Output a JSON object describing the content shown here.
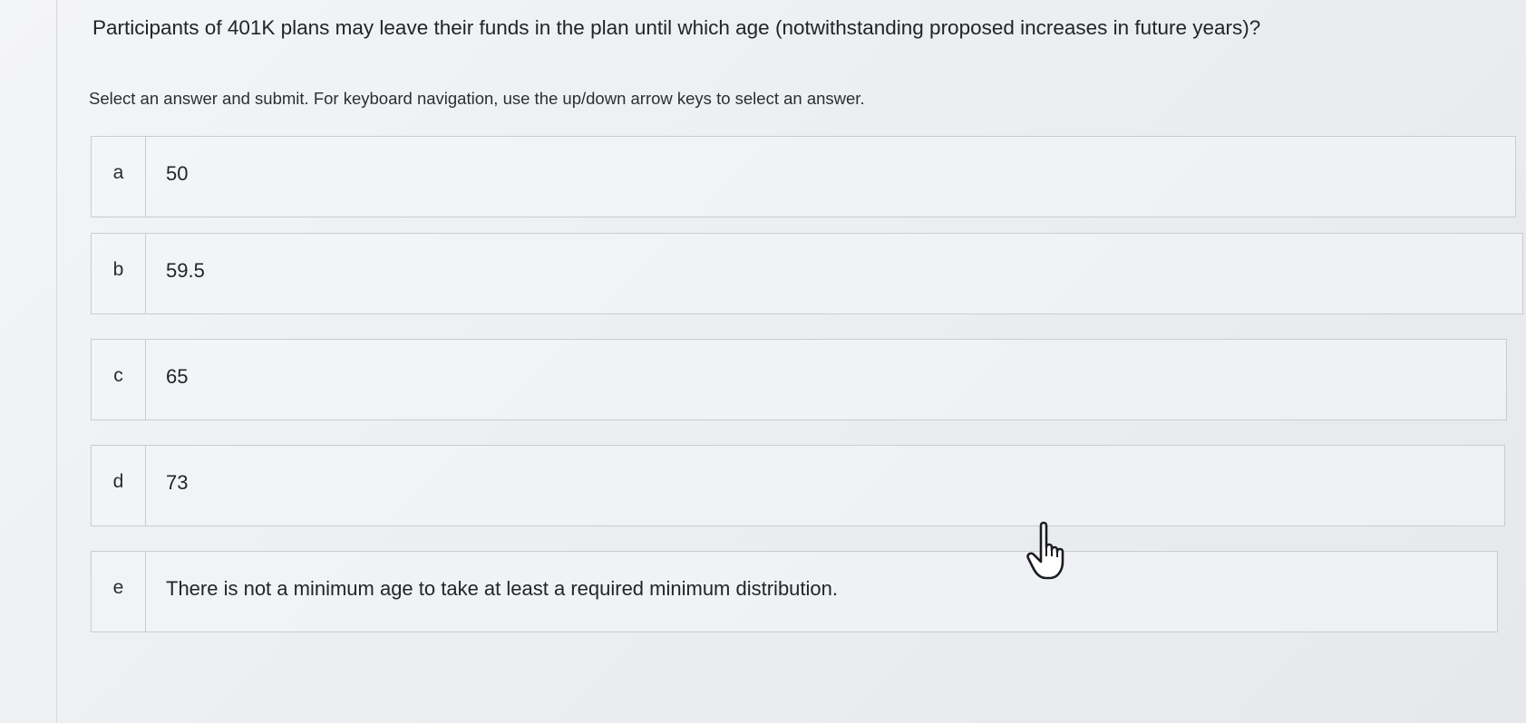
{
  "question": {
    "text": "Participants of 401K plans may leave their funds in the plan until which age (notwithstanding proposed increases in future years)?",
    "instructions": "Select an answer and submit. For keyboard navigation, use the up/down arrow keys to select an answer."
  },
  "options": [
    {
      "letter": "a",
      "text": "50"
    },
    {
      "letter": "b",
      "text": "59.5"
    },
    {
      "letter": "c",
      "text": "65"
    },
    {
      "letter": "d",
      "text": "73"
    },
    {
      "letter": "e",
      "text": "There is not a minimum age to take at least a required minimum distribution."
    }
  ],
  "cursor": {
    "icon": "hand-pointer-icon"
  }
}
